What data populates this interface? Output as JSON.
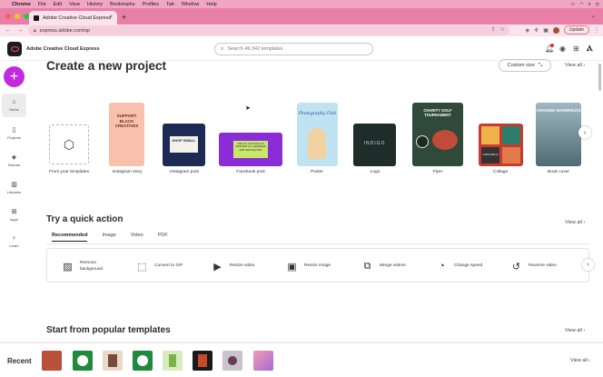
{
  "menubar": {
    "app": "Chrome",
    "items": [
      "File",
      "Edit",
      "View",
      "History",
      "Bookmarks",
      "Profiles",
      "Tab",
      "Window",
      "Help"
    ]
  },
  "browser": {
    "tab_title": "Adobe Creative Cloud Express",
    "url": "express.adobe.com/sp",
    "update_label": "Update"
  },
  "app": {
    "name": "Adobe Creative Cloud Express",
    "search_placeholder": "Search 49,342 templates"
  },
  "rail": {
    "items": [
      {
        "label": "Home",
        "icon": "home-icon"
      },
      {
        "label": "Projects",
        "icon": "projects-icon"
      },
      {
        "label": "Brands",
        "icon": "brands-icon"
      },
      {
        "label": "Libraries",
        "icon": "libraries-icon"
      },
      {
        "label": "Apps",
        "icon": "apps-icon"
      },
      {
        "label": "Learn",
        "icon": "learn-icon"
      }
    ]
  },
  "create": {
    "title": "Create a new project",
    "custom_size": "Custom size",
    "view_all": "View all",
    "cards": [
      {
        "label": "From your templates"
      },
      {
        "label": "Instagram story",
        "text": "SUPPORT BLACK CREATIVES"
      },
      {
        "label": "Instagram post",
        "text": "SHOP SMALL"
      },
      {
        "label": "Facebook post",
        "text": "KIDS AT JACKSON HS SUPPORT ALL GENDERS AND SEXUALITIES"
      },
      {
        "label": "Poster",
        "text": "Photography Club"
      },
      {
        "label": "Logo",
        "text": "INDIGO"
      },
      {
        "label": "Flyer",
        "text": "CHARITY GOLF TOURNAMENT"
      },
      {
        "label": "Collage",
        "text": "GROOVE IN"
      },
      {
        "label": "Book cover",
        "text": "CHASING MAVERICKS"
      }
    ]
  },
  "quick": {
    "title": "Try a quick action",
    "view_all": "View all",
    "tabs": [
      "Recommended",
      "Image",
      "Video",
      "PDF"
    ],
    "actions": [
      {
        "label": "Remove background",
        "icon": "remove-background-icon"
      },
      {
        "label": "Convert to GIF",
        "icon": "convert-gif-icon"
      },
      {
        "label": "Resize video",
        "icon": "resize-video-icon"
      },
      {
        "label": "Resize image",
        "icon": "resize-image-icon"
      },
      {
        "label": "Merge videos",
        "icon": "merge-videos-icon"
      },
      {
        "label": "Change speed",
        "icon": "change-speed-icon"
      },
      {
        "label": "Reverse video",
        "icon": "reverse-video-icon"
      }
    ]
  },
  "popular": {
    "title": "Start from popular templates",
    "view_all": "View all"
  },
  "recent": {
    "title": "Recent",
    "view_all": "View all"
  }
}
